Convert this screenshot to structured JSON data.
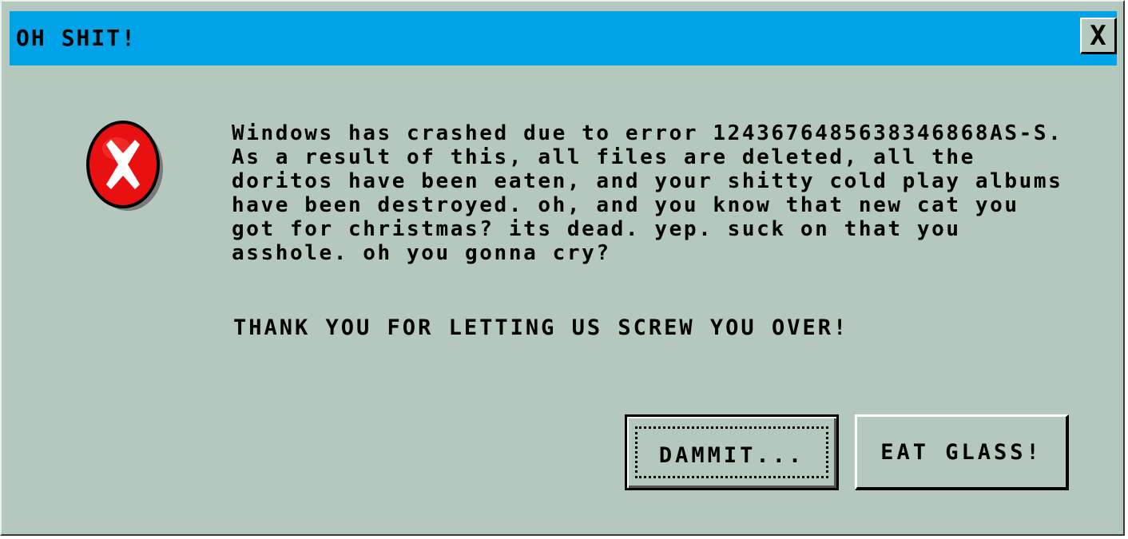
{
  "dialog": {
    "title": "OH SHIT!",
    "close_label": "X",
    "message_lines": [
      "Windows has crashed due to error 1243676485638346868AS-S.",
      "As a result of this, all files are deleted, all the",
      "doritos have been eaten, and your shitty cold play albums",
      "have been destroyed. oh, and you know that new cat you",
      "got for christmas? its dead. yep. suck on that you",
      "asshole. oh you gonna cry?"
    ],
    "thanks": "THANK YOU FOR LETTING US SCREW YOU OVER!",
    "buttons": {
      "dammit": "DAMMIT...",
      "eat_glass": "EAT GLASS!"
    }
  },
  "icons": {
    "error": "error-x-icon",
    "close": "close-icon"
  },
  "colors": {
    "title_bar": "#00a3e8",
    "window_bg": "#b5c8bd",
    "error_red": "#e81010"
  }
}
